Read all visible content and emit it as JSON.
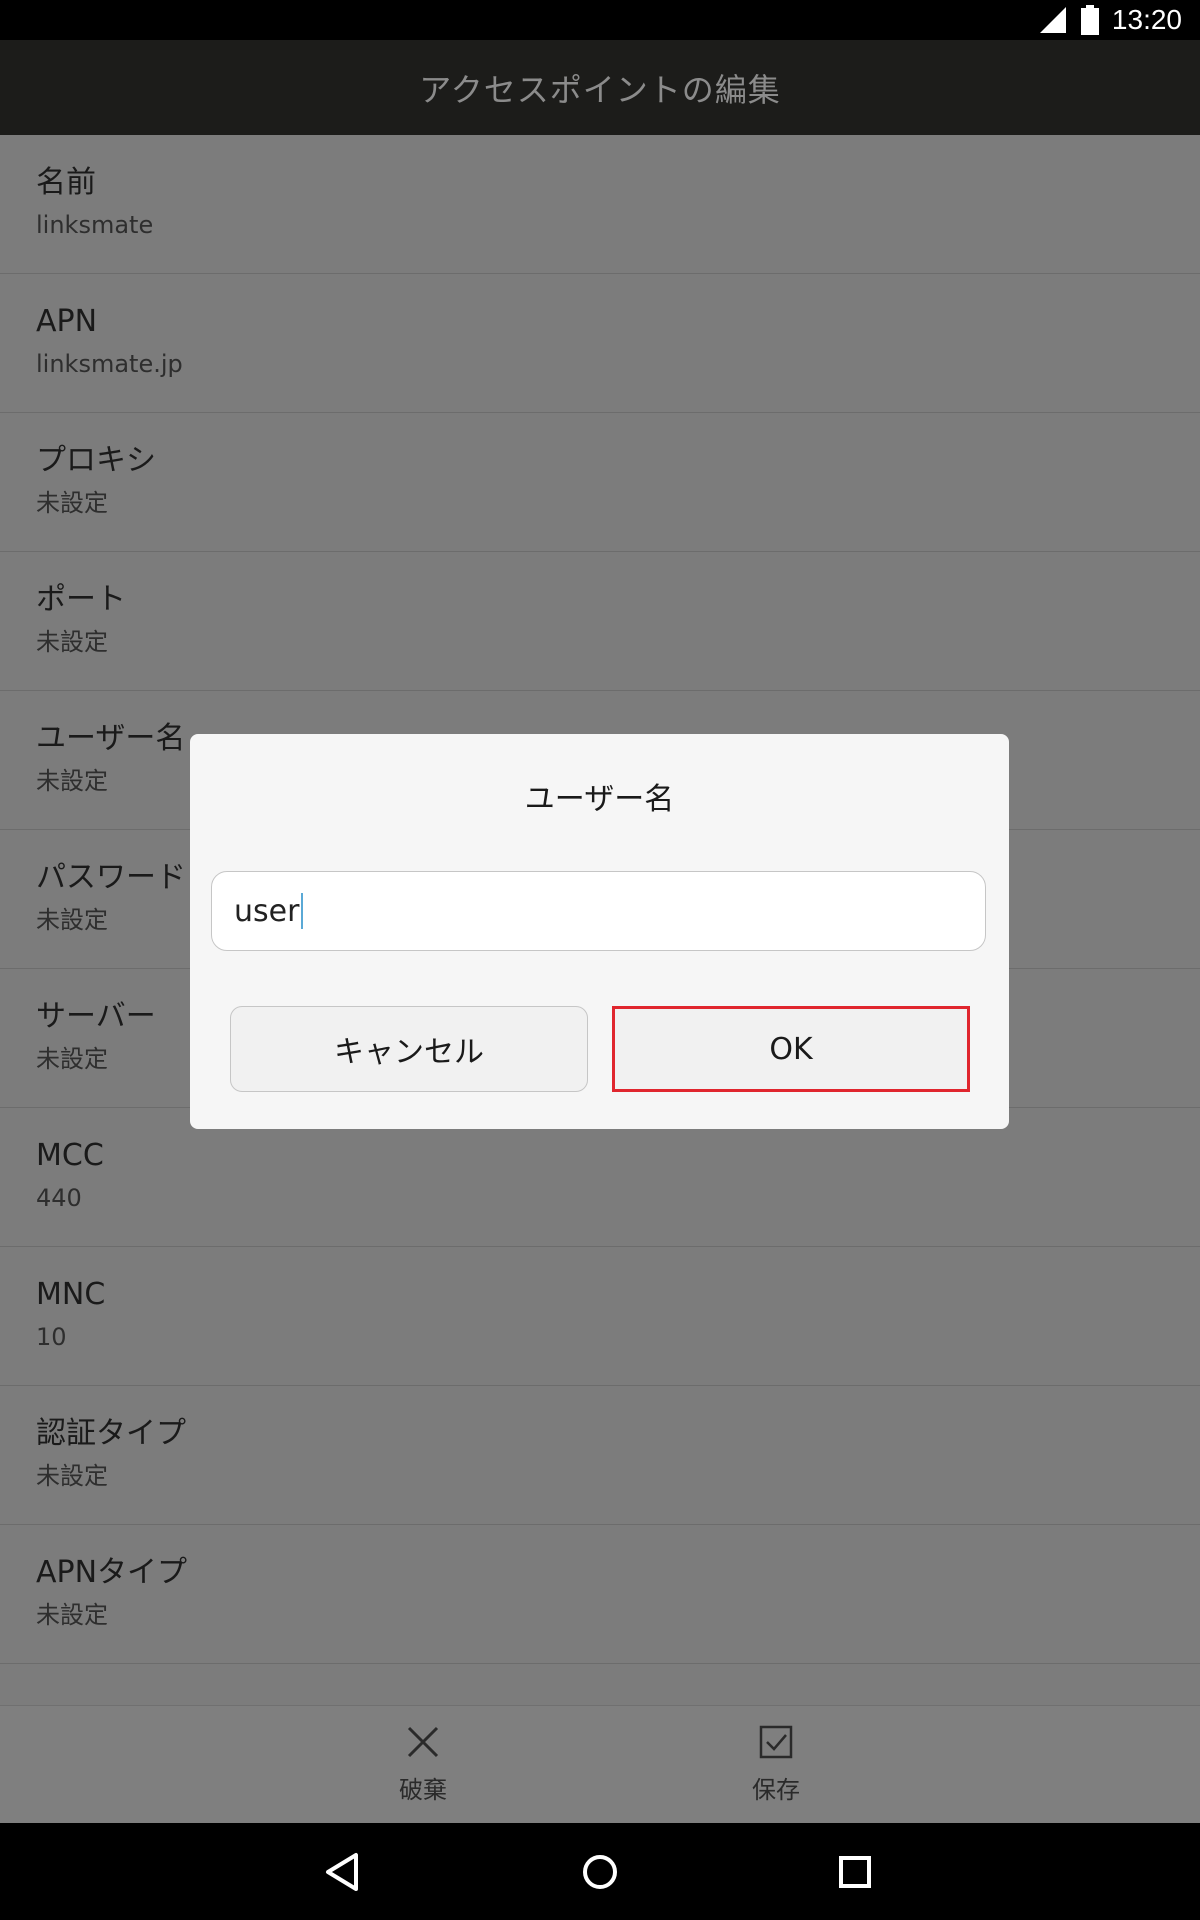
{
  "status": {
    "time": "13:20"
  },
  "appbar": {
    "title": "アクセスポイントの編集"
  },
  "settings": [
    {
      "title": "名前",
      "value": "linksmate"
    },
    {
      "title": "APN",
      "value": "linksmate.jp"
    },
    {
      "title": "プロキシ",
      "value": "未設定"
    },
    {
      "title": "ポート",
      "value": "未設定"
    },
    {
      "title": "ユーザー名",
      "value": "未設定"
    },
    {
      "title": "パスワード",
      "value": "未設定"
    },
    {
      "title": "サーバー",
      "value": "未設定"
    },
    {
      "title": "MCC",
      "value": "440"
    },
    {
      "title": "MNC",
      "value": "10"
    },
    {
      "title": "認証タイプ",
      "value": "未設定"
    },
    {
      "title": "APNタイプ",
      "value": "未設定"
    }
  ],
  "bottom_actions": {
    "discard_label": "破棄",
    "save_label": "保存"
  },
  "dialog": {
    "title": "ユーザー名",
    "input_value": "user",
    "cancel_label": "キャンセル",
    "ok_label": "OK"
  },
  "colors": {
    "highlight": "#e0262e",
    "caret": "#5aa9d6"
  }
}
